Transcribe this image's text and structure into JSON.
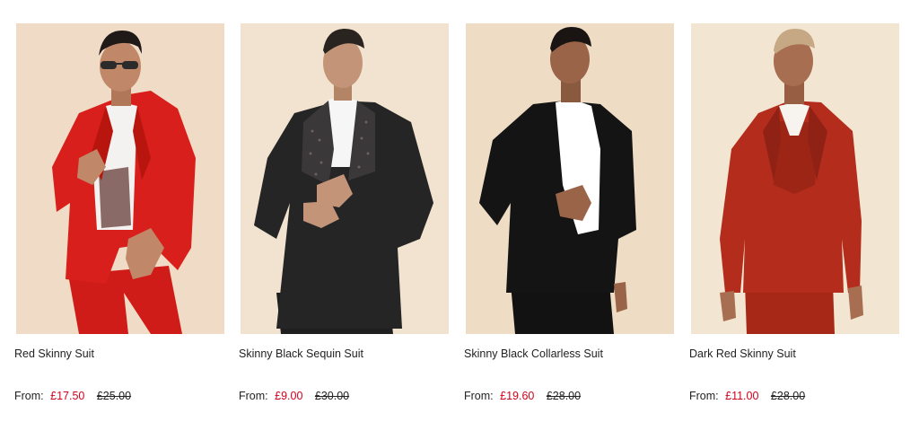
{
  "products": [
    {
      "name": "Red Skinny Suit",
      "from_label": "From:",
      "sale_price": "£17.50",
      "original_price": "£25.00",
      "image_alt": "model-in-red-skinny-suit",
      "colors": {
        "background": "#f0dcc6",
        "suit": "#d91f1b",
        "shirt": "#f4f2f0",
        "skin": "#c08868",
        "hair": "#1f1a17"
      }
    },
    {
      "name": "Skinny Black Sequin Suit",
      "from_label": "From:",
      "sale_price": "£9.00",
      "original_price": "£30.00",
      "image_alt": "model-in-black-sequin-suit",
      "colors": {
        "background": "#f1e3cf",
        "suit": "#252526",
        "shirt": "#f6f6f6",
        "skin": "#c49479",
        "hair": "#2a2420"
      }
    },
    {
      "name": "Skinny Black Collarless Suit",
      "from_label": "From:",
      "sale_price": "£19.60",
      "original_price": "£28.00",
      "image_alt": "model-in-black-collarless-suit",
      "colors": {
        "background": "#efdcc5",
        "suit": "#141414",
        "shirt": "#ffffff",
        "skin": "#9a6449",
        "hair": "#1a1512"
      }
    },
    {
      "name": "Dark Red Skinny Suit",
      "from_label": "From:",
      "sale_price": "£11.00",
      "original_price": "£28.00",
      "image_alt": "model-in-dark-red-suit",
      "colors": {
        "background": "#f2e5d1",
        "suit": "#b32c1c",
        "shirt": "#f7f4f0",
        "skin": "#a86e52",
        "hair": "#c7a884"
      }
    }
  ]
}
